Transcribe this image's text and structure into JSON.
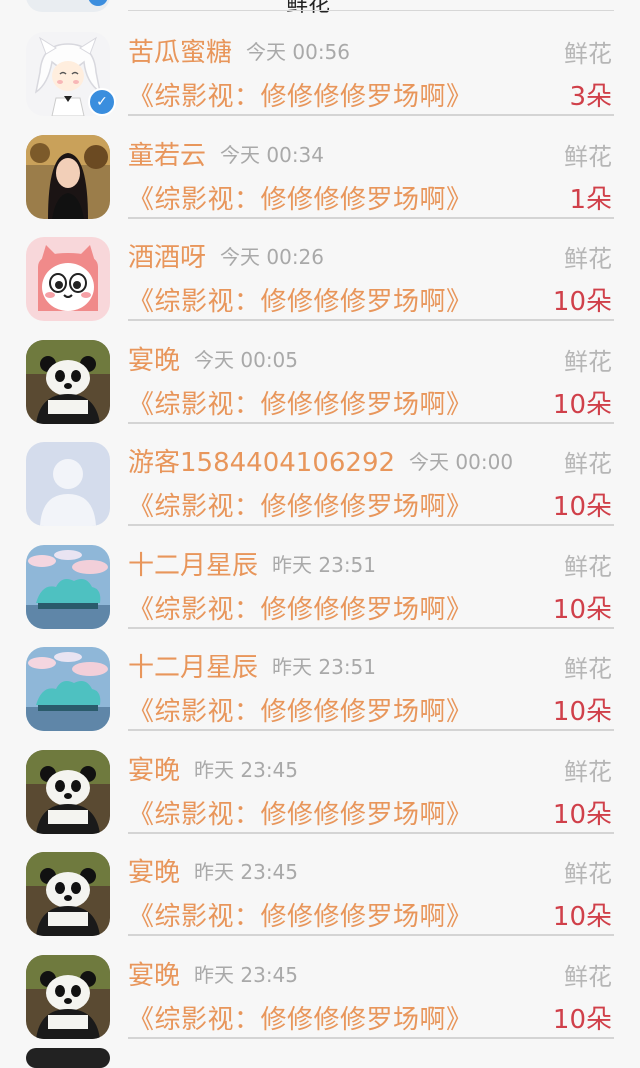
{
  "header": {
    "fragment_label": "鲜花"
  },
  "rows": [
    {
      "name": "苦瓜蜜糖",
      "time": "今天 00:56",
      "gift": "鲜花",
      "book": "《综影视：修修修修罗场啊》",
      "count": "3朵",
      "avatar": "cat-girl",
      "verified": true,
      "verified_icon": "✓"
    },
    {
      "name": "童若云",
      "time": "今天 00:34",
      "gift": "鲜花",
      "book": "《综影视：修修修修罗场啊》",
      "count": "1朵",
      "avatar": "woman-portrait",
      "verified": false
    },
    {
      "name": "酒酒呀",
      "time": "今天 00:26",
      "gift": "鲜花",
      "book": "《综影视：修修修修罗场啊》",
      "count": "10朵",
      "avatar": "pink-cat",
      "verified": false
    },
    {
      "name": "宴晚",
      "time": "今天 00:05",
      "gift": "鲜花",
      "book": "《综影视：修修修修罗场啊》",
      "count": "10朵",
      "avatar": "panda",
      "verified": false
    },
    {
      "name": "游客1584404106292",
      "time": "今天 00:00",
      "gift": "鲜花",
      "book": "《综影视：修修修修罗场啊》",
      "count": "10朵",
      "avatar": "default-user",
      "verified": false
    },
    {
      "name": "十二月星辰",
      "time": "昨天 23:51",
      "gift": "鲜花",
      "book": "《综影视：修修修修罗场啊》",
      "count": "10朵",
      "avatar": "tree-island",
      "verified": false
    },
    {
      "name": "十二月星辰",
      "time": "昨天 23:51",
      "gift": "鲜花",
      "book": "《综影视：修修修修罗场啊》",
      "count": "10朵",
      "avatar": "tree-island",
      "verified": false
    },
    {
      "name": "宴晚",
      "time": "昨天 23:45",
      "gift": "鲜花",
      "book": "《综影视：修修修修罗场啊》",
      "count": "10朵",
      "avatar": "panda",
      "verified": false
    },
    {
      "name": "宴晚",
      "time": "昨天 23:45",
      "gift": "鲜花",
      "book": "《综影视：修修修修罗场啊》",
      "count": "10朵",
      "avatar": "panda",
      "verified": false
    },
    {
      "name": "宴晚",
      "time": "昨天 23:45",
      "gift": "鲜花",
      "book": "《综影视：修修修修罗场啊》",
      "count": "10朵",
      "avatar": "panda",
      "verified": false
    }
  ],
  "colors": {
    "name": "#e8965b",
    "count": "#d0404a",
    "muted": "#a9a9a9",
    "badge": "#3a8ede"
  }
}
